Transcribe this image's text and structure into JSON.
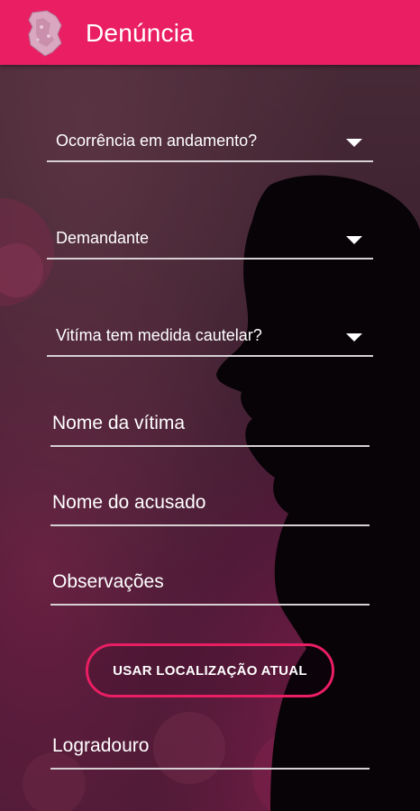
{
  "app_bar": {
    "title": "Denúncia",
    "color": "#e91e63",
    "logo_icon": "map-logo-icon"
  },
  "form": {
    "dropdowns": [
      {
        "label": "Ocorrência em andamento?"
      },
      {
        "label": "Demandante"
      },
      {
        "label": "Vitíma tem medida cautelar?"
      }
    ],
    "text_fields": [
      {
        "hint": "Nome da vítima"
      },
      {
        "hint": "Nome do acusado"
      },
      {
        "hint": "Observações"
      }
    ],
    "location_button": "USAR LOCALIZAÇÃO ATUAL",
    "address_field": {
      "hint": "Logradouro"
    }
  }
}
